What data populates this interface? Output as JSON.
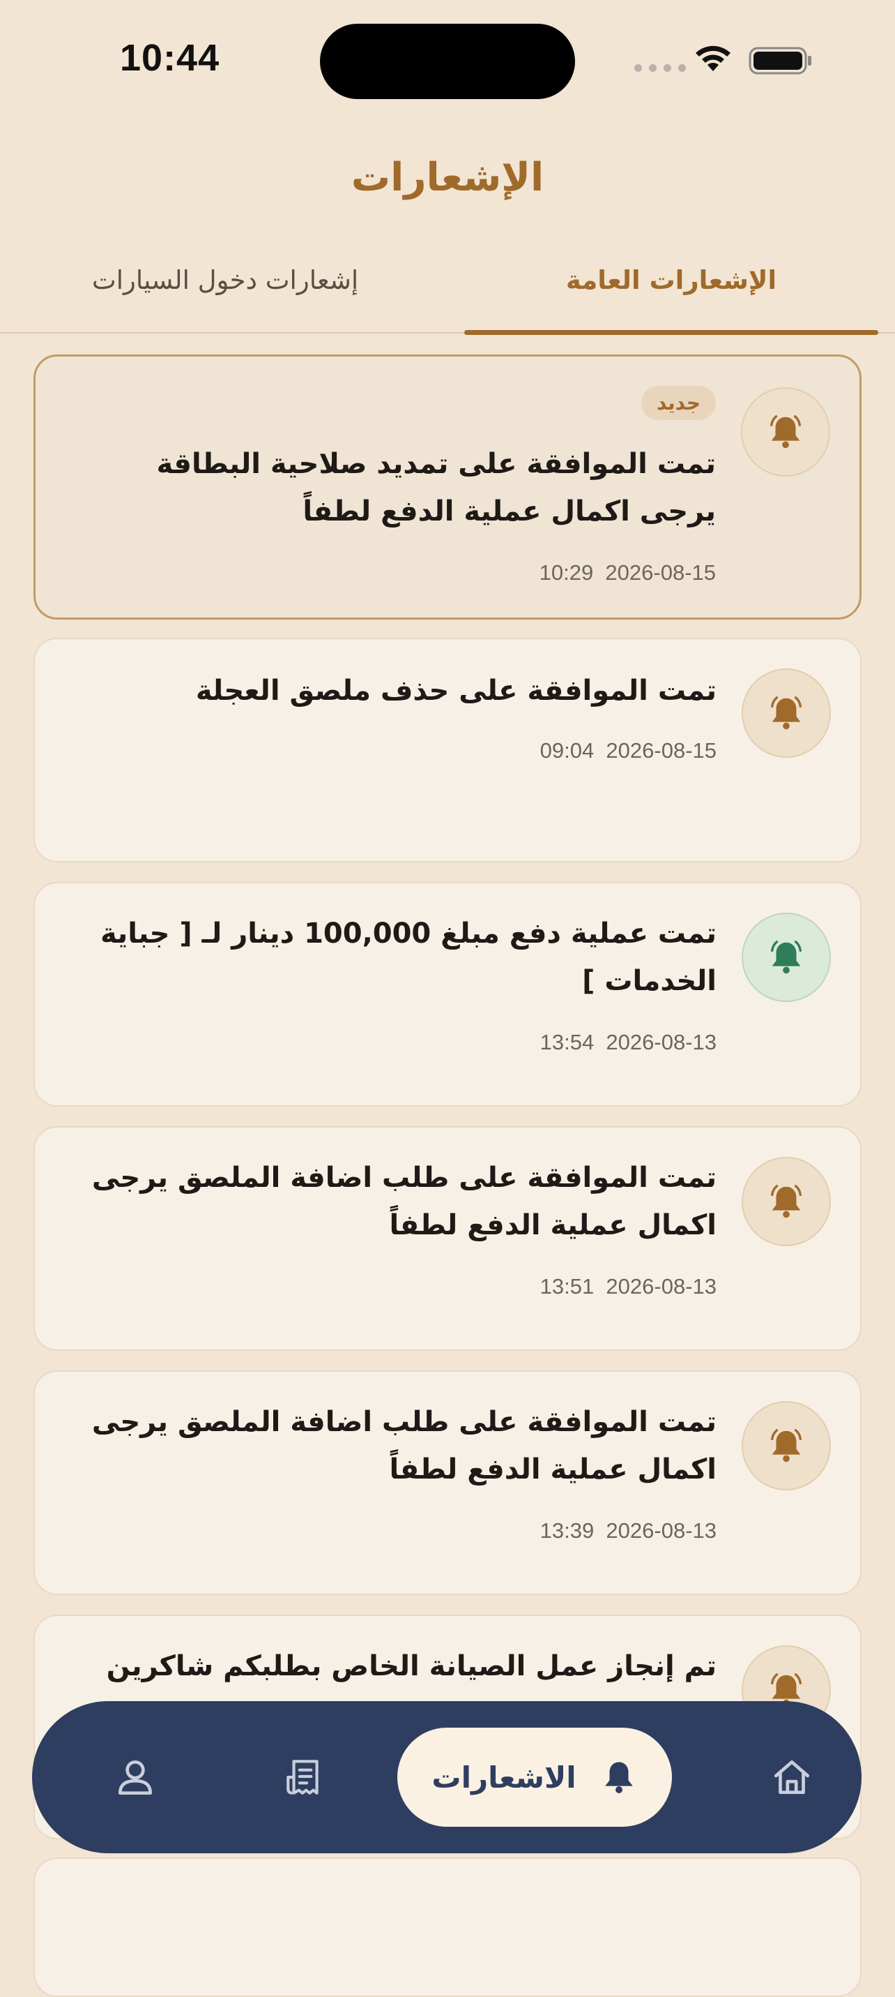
{
  "status_bar": {
    "time": "10:44"
  },
  "header": {
    "title": "الإشعارات"
  },
  "tabs": [
    {
      "label": "الإشعارات العامة",
      "active": true
    },
    {
      "label": "إشعارات دخول السيارات",
      "active": false
    }
  ],
  "notifications": [
    {
      "badge": "جديد",
      "text": "تمت الموافقة على تمديد صلاحية البطاقة يرجى اكمال عملية الدفع لطفاً",
      "date": "2026-08-15",
      "time": "10:29",
      "icon": "bell-icon",
      "unread": true
    },
    {
      "text": "تمت الموافقة على حذف ملصق العجلة",
      "date": "2026-08-15",
      "time": "09:04",
      "icon": "bell-icon",
      "unread": false
    },
    {
      "text": "تمت عملية دفع مبلغ 100,000 دينار لـ [ جباية الخدمات ]",
      "date": "2026-08-13",
      "time": "13:54",
      "icon": "bell-icon-green",
      "unread": false
    },
    {
      "text": "تمت الموافقة على طلب اضافة الملصق يرجى اكمال عملية الدفع لطفاً",
      "date": "2026-08-13",
      "time": "13:51",
      "icon": "bell-icon",
      "unread": false
    },
    {
      "text": "تمت الموافقة على طلب اضافة الملصق يرجى اكمال عملية الدفع لطفاً",
      "date": "2026-08-13",
      "time": "13:39",
      "icon": "bell-icon",
      "unread": false
    },
    {
      "text": "تم إنجاز عمل الصيانة الخاص بطلبكم شاكرين",
      "icon": "bell-icon",
      "unread": false
    }
  ],
  "bottom_nav": {
    "active_label": "الاشعارات",
    "items": [
      "home-icon",
      "bell-icon",
      "receipt-icon",
      "profile-icon"
    ]
  },
  "colors": {
    "background": "#F2E5D3",
    "accent": "#A06A2B",
    "nav_bg": "#2E3E60",
    "green_bell": "#2E7D5B"
  }
}
